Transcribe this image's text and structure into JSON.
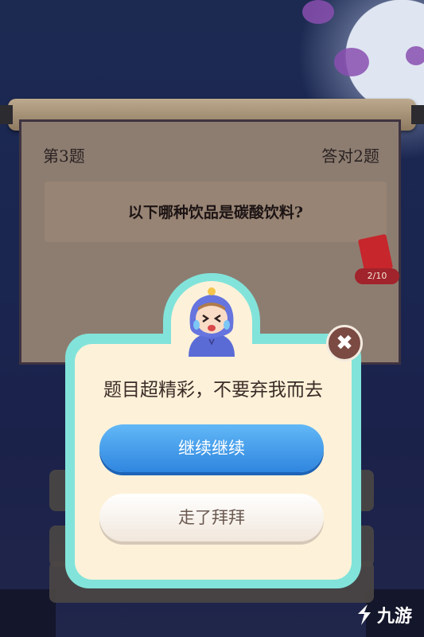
{
  "quiz": {
    "question_number": "第3题",
    "correct_count": "答对2题",
    "question": "以下哪种饮品是碳酸饮料?",
    "reward_progress": "2/10"
  },
  "dialog": {
    "message": "题目超精彩，不要弃我而去",
    "continue_label": "继续继续",
    "leave_label": "走了拜拜",
    "close_symbol": "✖"
  },
  "watermark": {
    "text": "九游"
  },
  "colors": {
    "dialog_border": "#82e3da",
    "dialog_fill": "#fdf2d9",
    "continue_button": "#3f96e8",
    "close_button": "#7a4a43"
  },
  "icons": [
    "crying-avatar-icon",
    "red-packet-icon",
    "close-icon",
    "jiuyou-logo-icon"
  ]
}
